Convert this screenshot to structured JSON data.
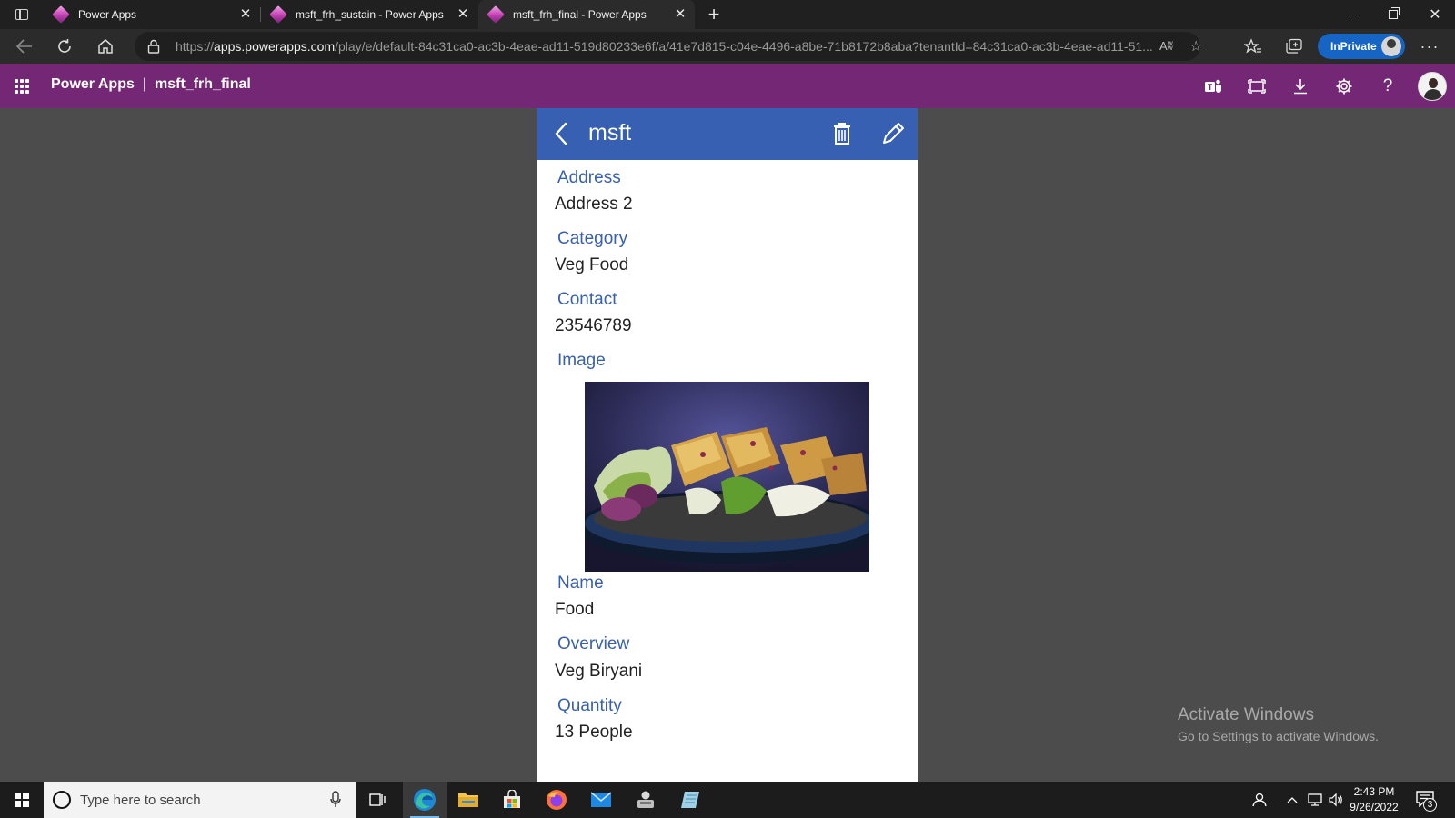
{
  "browser": {
    "tabs": [
      {
        "title": "Power Apps"
      },
      {
        "title": "msft_frh_sustain - Power Apps"
      },
      {
        "title": "msft_frh_final - Power Apps"
      }
    ],
    "url_prefix": "https://",
    "url_host": "apps.powerapps.com",
    "url_path": "/play/e/default-84c31ca0-ac3b-4eae-ad11-519d80233e6f/a/41e7d815-c04e-4496-a8be-71b8172b8aba?tenantId=84c31ca0-ac3b-4eae-ad11-51...",
    "read_aloud": "Aʬ",
    "inprivate_label": "InPrivate"
  },
  "appbar": {
    "product": "Power Apps",
    "separator": "|",
    "app_name": "msft_frh_final"
  },
  "screen": {
    "title": "msft",
    "header_color": "#3860b2",
    "fields": [
      {
        "label": "Address",
        "value": "Address 2"
      },
      {
        "label": "Category",
        "value": "Veg Food"
      },
      {
        "label": "Contact",
        "value": "23546789"
      },
      {
        "label": "Image",
        "value": ""
      },
      {
        "label": "Name",
        "value": "Food"
      },
      {
        "label": "Overview",
        "value": "Veg Biryani"
      },
      {
        "label": "Quantity",
        "value": "13 People"
      }
    ]
  },
  "watermark": {
    "line1": "Activate Windows",
    "line2": "Go to Settings to activate Windows."
  },
  "taskbar": {
    "search_placeholder": "Type here to search",
    "time": "2:43 PM",
    "date": "9/26/2022",
    "notification_count": "3"
  },
  "colors": {
    "appbar": "#742774",
    "label": "#3860b2"
  }
}
